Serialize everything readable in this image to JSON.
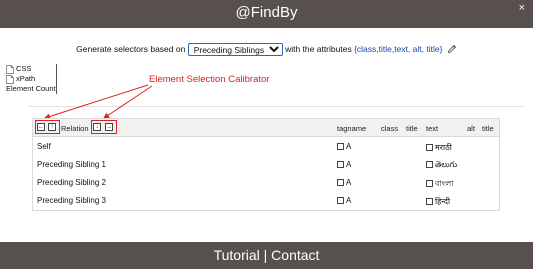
{
  "header": {
    "title": "@FindBy",
    "close_label": "×"
  },
  "generator": {
    "prefix": "Generate selectors based on",
    "selected_option": "Preceding Siblings",
    "middle": "with the attributes",
    "attributes_text": "{class,title,text, alt, title}",
    "edit_icon": "pencil-icon"
  },
  "side_options": [
    {
      "label": "CSS",
      "icon": "document-icon"
    },
    {
      "label": "xPath",
      "icon": "document-icon"
    },
    {
      "label": "Element Count",
      "icon": ""
    }
  ],
  "annotation": {
    "label": "Element Selection Calibrator",
    "color": "#e02020"
  },
  "table": {
    "nav_buttons": [
      {
        "symbol": "←",
        "icon": "arrow-left-icon"
      },
      {
        "symbol": "↑",
        "icon": "arrow-up-icon"
      },
      {
        "symbol": "↓",
        "icon": "arrow-down-icon"
      },
      {
        "symbol": "→",
        "icon": "arrow-right-icon"
      }
    ],
    "columns": [
      "Relation",
      "tagname",
      "class",
      "title",
      "text",
      "alt",
      "title"
    ],
    "rows": [
      {
        "relation": "Self",
        "tagname": "A",
        "text": "मराठी"
      },
      {
        "relation": "Preceding Sibling 1",
        "tagname": "A",
        "text": "తెలుగు"
      },
      {
        "relation": "Preceding Sibling 2",
        "tagname": "A",
        "text": "বাংলা"
      },
      {
        "relation": "Preceding Sibling 3",
        "tagname": "A",
        "text": "हिन्दी"
      }
    ]
  },
  "footer": {
    "tutorial": "Tutorial",
    "separator": "|",
    "contact": "Contact"
  },
  "colors": {
    "bar": "#58504c",
    "accent": "#2a66c8",
    "attributes": "#1f3fb0"
  }
}
